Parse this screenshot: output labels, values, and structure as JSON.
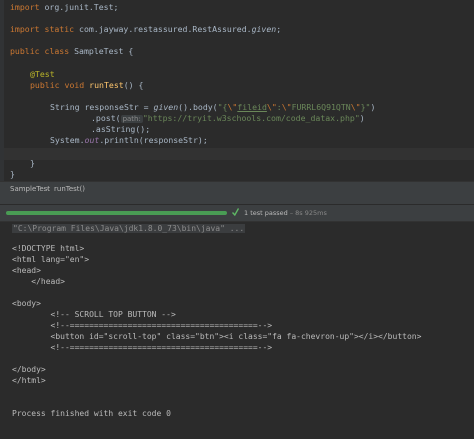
{
  "editor": {
    "line1": {
      "keyword": "import",
      "text": " org.junit.Test;"
    },
    "line2": {
      "keyword1": "import",
      "keyword2": "static",
      "text": " com.jayway.restassured.RestAssured.",
      "member": "given",
      "end": ";"
    },
    "line3": {
      "keyword1": "public",
      "keyword2": "class",
      "text": " SampleTest {"
    },
    "line4": {
      "annotation": "@Test"
    },
    "line5": {
      "keyword1": "public",
      "keyword2": "void",
      "method": "runTest",
      "text": "() {"
    },
    "line6": {
      "text1": "String responseStr = ",
      "call": "given",
      "text2": "().body(",
      "str1": "\"{",
      "esc1": "\\\"",
      "fld": "fileid",
      "esc2": "\\\"",
      "str2": ":",
      "esc3": "\\\"",
      "str3": "FURRL6Q91QTN",
      "esc4": "\\\"",
      "str4": "}\"",
      "end": ")"
    },
    "line7": {
      "text1": ".post(",
      "hint": "path:",
      "str": "\"https://tryit.w3schools.com/code_datax.php\"",
      "end": ")"
    },
    "line8": {
      "text": ".asString();"
    },
    "line9": {
      "text1": "System.",
      "field": "out",
      "text2": ".println(responseStr);"
    },
    "line10": {
      "text": "}"
    },
    "line11": {
      "text": "}"
    }
  },
  "breadcrumb": {
    "item1": "SampleTest",
    "separator": "›",
    "item2": "runTest()"
  },
  "run_status": {
    "progress": 1.0,
    "status": "1 test passed",
    "time": "– 8s 925ms"
  },
  "console": {
    "command": "\"C:\\Program Files\\Java\\jdk1.8.0_73\\bin\\java\" ...",
    "lines": [
      "<!DOCTYPE html>",
      "<html lang=\"en\">",
      "<head>",
      "    </head>",
      "",
      "<body>",
      "        <!-- SCROLL TOP BUTTON -->",
      "        <!--=======================================-->",
      "        <button id=\"scroll-top\" class=\"btn\"><i class=\"fa fa-chevron-up\"></i></button>",
      "        <!--=======================================-->",
      "",
      "</body>",
      "</html>",
      "",
      "",
      "Process finished with exit code 0"
    ]
  },
  "colors": {
    "keyword": "#cc7832",
    "string": "#6a8759",
    "annotation": "#bbb529",
    "method": "#ffc66d",
    "progress": "#499c54"
  }
}
